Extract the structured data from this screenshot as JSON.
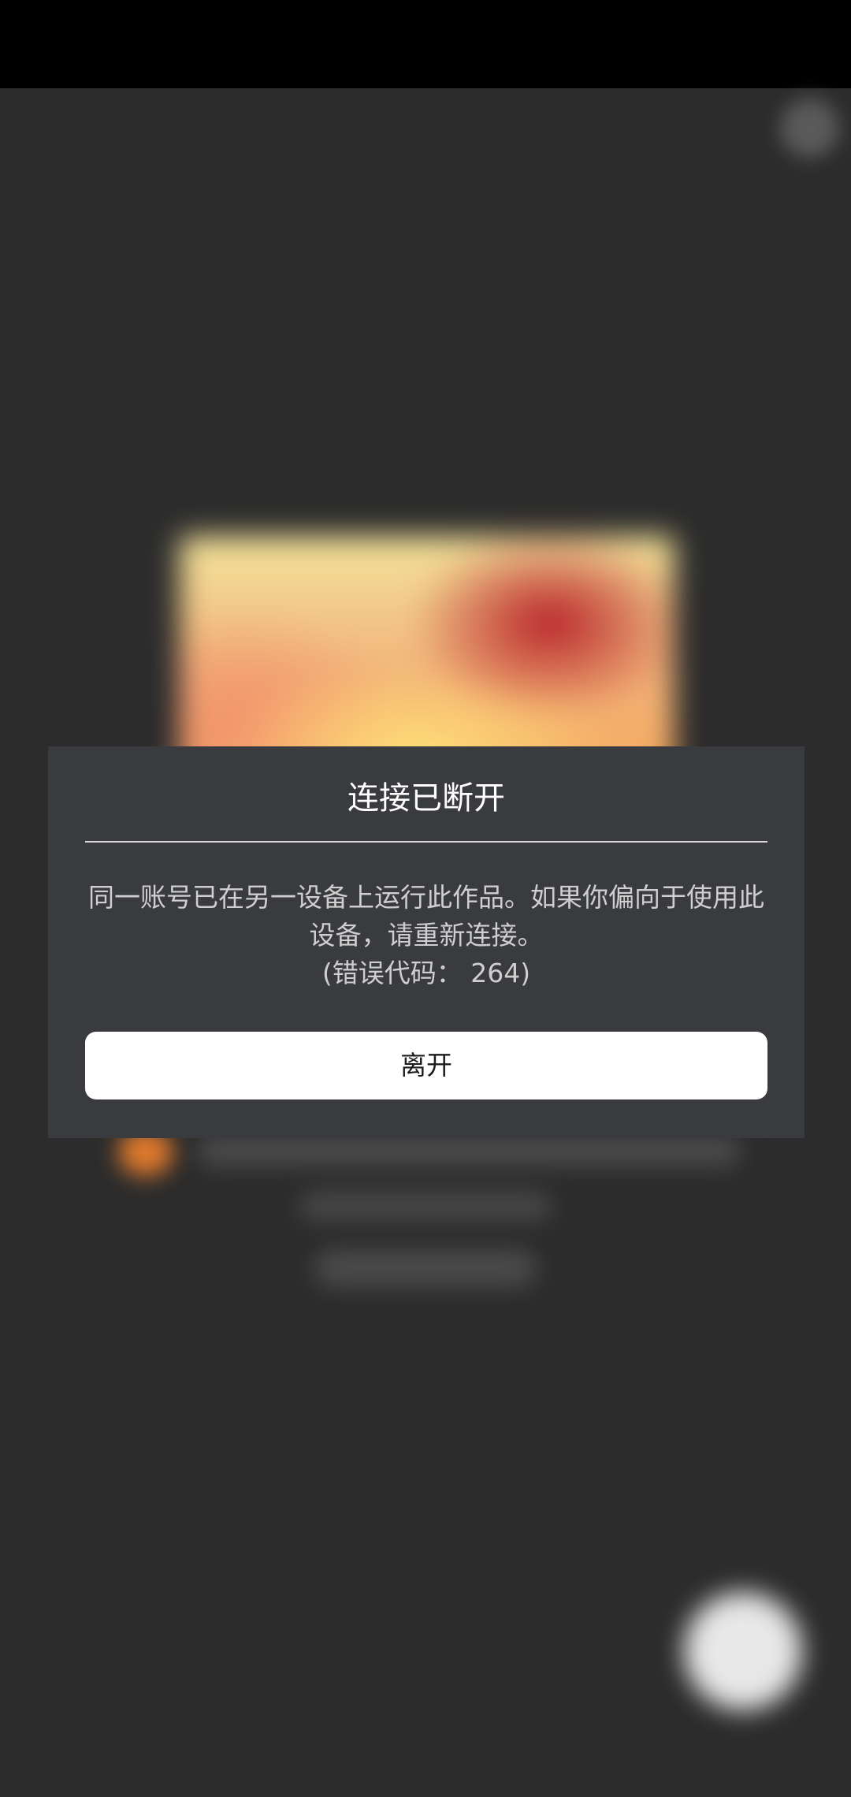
{
  "dialog": {
    "title": "连接已断开",
    "message": "同一账号已在另一设备上运行此作品。如果你偏向于使用此设备，请重新连接。",
    "error_code_text": "(错误代码： 264)",
    "leave_button_label": "离开"
  },
  "colors": {
    "background": "#2c2c2c",
    "status_bar": "#000000",
    "dialog_background": "#393b3e",
    "button_background": "#ffffff",
    "title_text": "#ffffff",
    "body_text": "#cfcfcf"
  }
}
